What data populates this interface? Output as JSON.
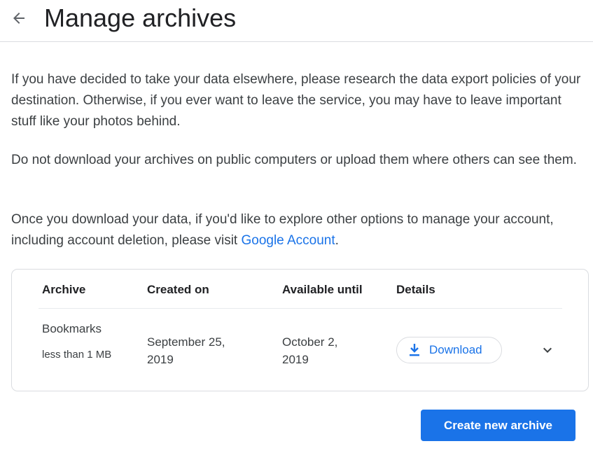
{
  "header": {
    "back_icon": "arrow-back-icon",
    "title": "Manage archives"
  },
  "body": {
    "paragraph1": "If you have decided to take your data elsewhere, please research the data export policies of your destination. Otherwise, if you ever want to leave the service, you may have to leave important stuff like your photos behind.",
    "paragraph2": "Do not download your archives on public computers or upload them where others can see them.",
    "paragraph3_prefix": "Once you download your data, if you'd like to explore other options to manage your account, including account deletion, please visit ",
    "paragraph3_link": "Google Account",
    "paragraph3_suffix": "."
  },
  "archive_table": {
    "columns": [
      "Archive",
      "Created on",
      "Available until",
      "Details"
    ],
    "rows": [
      {
        "name": "Bookmarks",
        "size": "less than 1 MB",
        "created_on": "September 25, 2019",
        "available_until": "October 2, 2019",
        "download_label": "Download",
        "download_icon": "download-icon",
        "expand_icon": "chevron-down-icon"
      }
    ]
  },
  "actions": {
    "create_label": "Create new archive"
  },
  "colors": {
    "accent": "#1a73e8",
    "text": "#202124",
    "secondary_text": "#3c4043",
    "border": "#dadce0"
  }
}
